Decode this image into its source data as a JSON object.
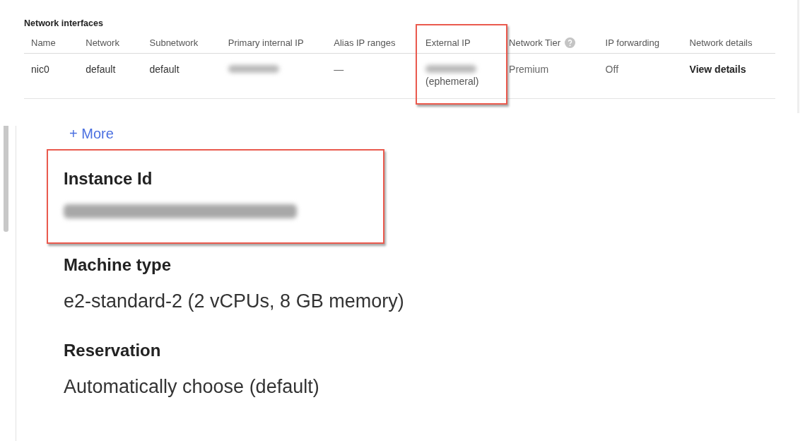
{
  "network_interfaces": {
    "title": "Network interfaces",
    "columns": [
      {
        "label": "Name"
      },
      {
        "label": "Network"
      },
      {
        "label": "Subnetwork"
      },
      {
        "label": "Primary internal IP"
      },
      {
        "label": "Alias IP ranges"
      },
      {
        "label": "External IP",
        "highlighted": true
      },
      {
        "label": "Network Tier",
        "help": true
      },
      {
        "label": "IP forwarding"
      },
      {
        "label": "Network details"
      }
    ],
    "rows": [
      [
        {
          "kind": "text",
          "text": "nic0"
        },
        {
          "kind": "text",
          "text": "default"
        },
        {
          "kind": "text",
          "text": "default"
        },
        {
          "kind": "redacted"
        },
        {
          "kind": "muted",
          "text": "—"
        },
        {
          "kind": "redacted",
          "subtext": "(ephemeral)"
        },
        {
          "kind": "muted",
          "text": "Premium"
        },
        {
          "kind": "muted",
          "text": "Off"
        },
        {
          "kind": "link",
          "text": "View details"
        }
      ]
    ]
  },
  "details": {
    "more_link": "+ More",
    "fields": [
      {
        "label": "Instance Id",
        "kind": "redacted",
        "highlighted": true
      },
      {
        "label": "Machine type",
        "kind": "text",
        "value": "e2-standard-2 (2 vCPUs, 8 GB memory)"
      },
      {
        "label": "Reservation",
        "kind": "text",
        "value": "Automatically choose (default)"
      }
    ]
  }
}
